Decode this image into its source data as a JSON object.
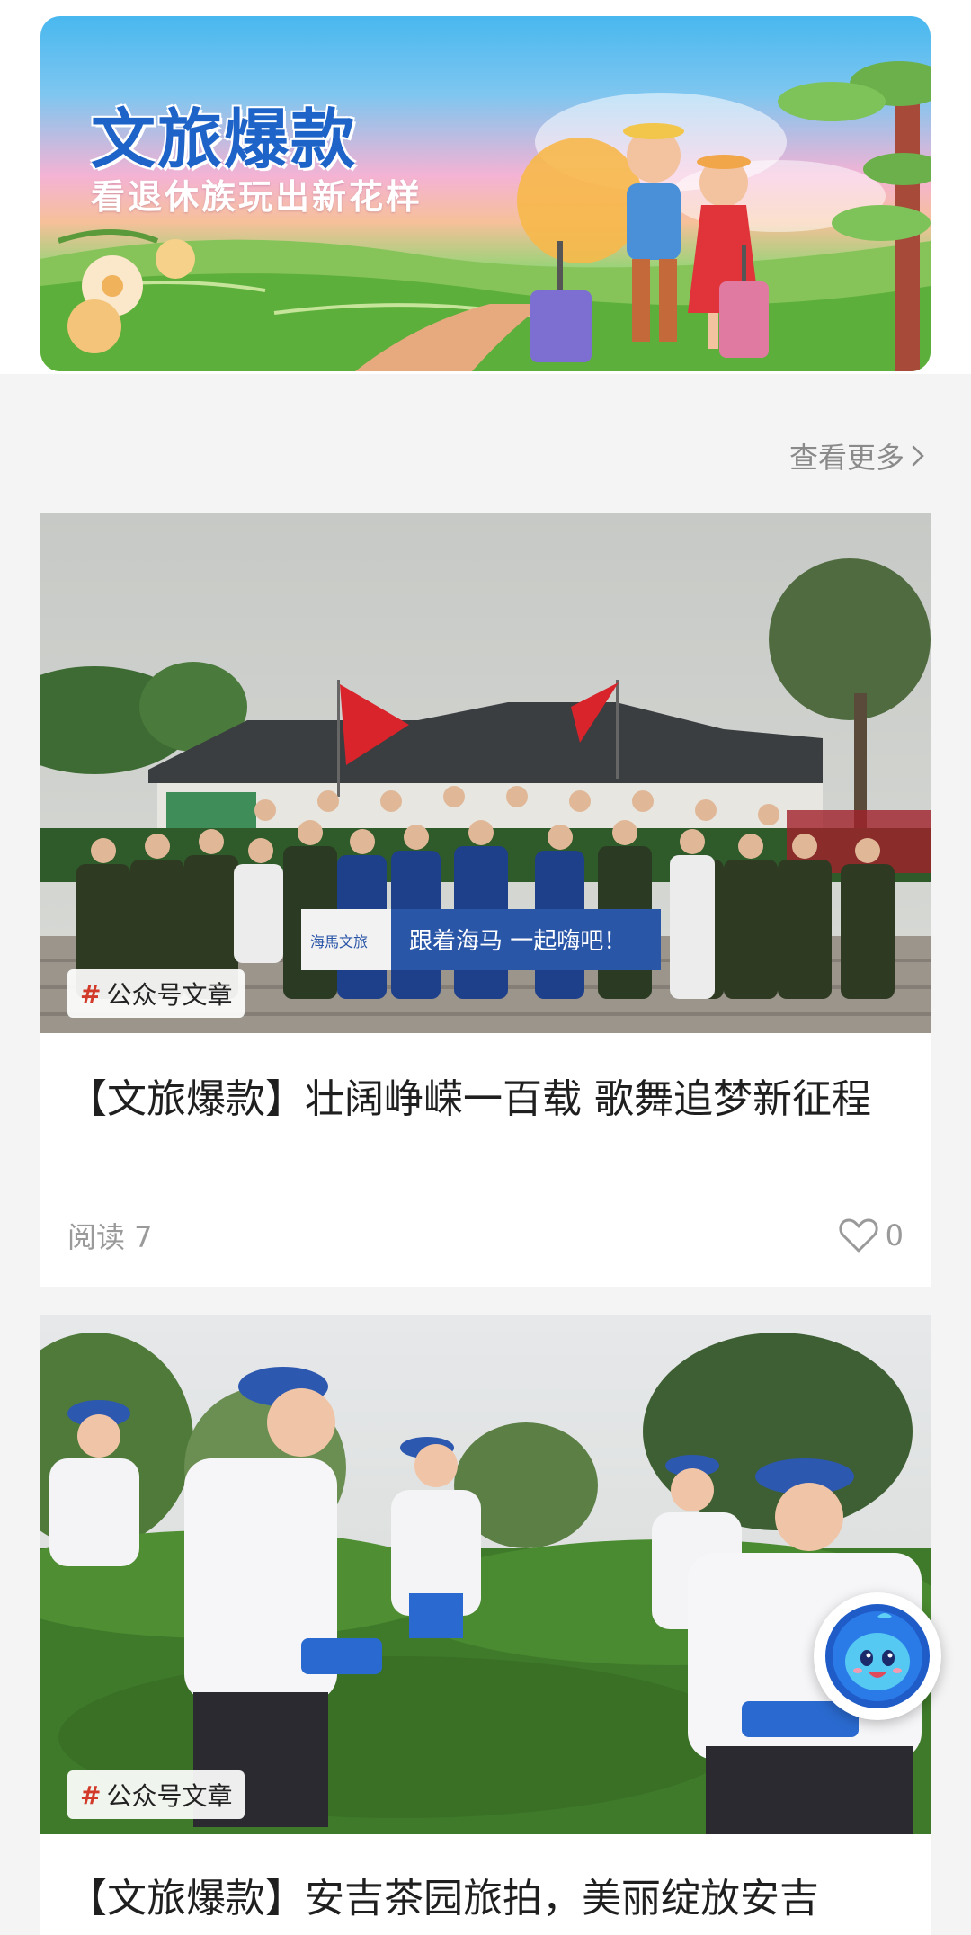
{
  "banner": {
    "title": "文旅爆款",
    "subtitle": "看退休族玩出新花样"
  },
  "section": {
    "more_label": "查看更多"
  },
  "articles": [
    {
      "tag_hash": "#",
      "tag_label": "公众号文章",
      "title": "【文旅爆款】壮阔峥嵘一百载 歌舞追梦新征程",
      "read_label": "阅读 7",
      "likes": "0",
      "banner_text": "跟着海马 一起嗨吧！",
      "banner_brand": "海馬文旅"
    },
    {
      "tag_hash": "#",
      "tag_label": "公众号文章",
      "title": "【文旅爆款】安吉茶园旅拍，美丽绽放安吉"
    }
  ],
  "colors": {
    "accent_red": "#d23b2a",
    "muted_text": "#9a9a9a",
    "page_bg": "#f4f4f4",
    "banner_blue": "#1e63c8"
  },
  "icons": {
    "more": "chevron-right-icon",
    "like": "heart-outline-icon",
    "assistant": "mascot-assistant-icon"
  }
}
